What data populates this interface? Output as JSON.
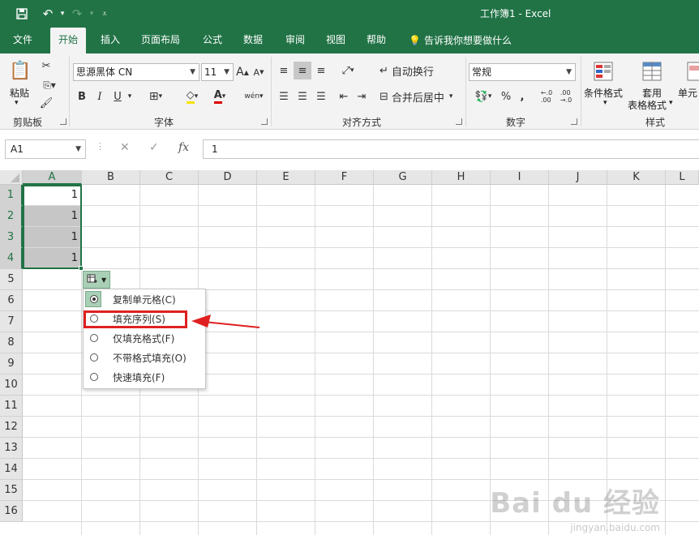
{
  "window": {
    "title": "工作簿1  -  Excel"
  },
  "quick_access": {
    "save_icon": "save-icon",
    "undo_icon": "undo-icon",
    "redo_icon": "redo-icon",
    "customize_icon": "customize-icon"
  },
  "tabs": [
    {
      "label": "文件"
    },
    {
      "label": "开始"
    },
    {
      "label": "插入"
    },
    {
      "label": "页面布局"
    },
    {
      "label": "公式"
    },
    {
      "label": "数据"
    },
    {
      "label": "审阅"
    },
    {
      "label": "视图"
    },
    {
      "label": "帮助"
    }
  ],
  "tell_me": "告诉我你想要做什么",
  "ribbon": {
    "clipboard": {
      "paste_label": "粘贴",
      "group_label": "剪贴板"
    },
    "font": {
      "font_name": "思源黑体 CN",
      "font_size": "11",
      "group_label": "字体",
      "bold": "B",
      "italic": "I",
      "underline": "U"
    },
    "alignment": {
      "wrap_text": "自动换行",
      "merge_center": "合并后居中",
      "group_label": "对齐方式"
    },
    "number": {
      "format": "常规",
      "percent": "%",
      "comma": ",",
      "group_label": "数字"
    },
    "styles": {
      "conditional": "条件格式",
      "table_line1": "套用",
      "table_line2": "表格格式",
      "cell_styles": "单元",
      "group_label": "样式"
    }
  },
  "formula_bar": {
    "name_box": "A1",
    "cancel": "✕",
    "enter": "✓",
    "fx": "fx",
    "value": "1"
  },
  "columns": [
    "A",
    "B",
    "C",
    "D",
    "E",
    "F",
    "G",
    "H",
    "I",
    "J",
    "K",
    "L"
  ],
  "rows": [
    "1",
    "2",
    "3",
    "4",
    "5",
    "6",
    "7",
    "8",
    "9",
    "10",
    "11",
    "12",
    "13",
    "14",
    "15",
    "16"
  ],
  "cells": {
    "A1": "1",
    "A2": "1",
    "A3": "1",
    "A4": "1"
  },
  "autofill_menu": {
    "items": [
      {
        "label": "复制单元格(C)",
        "selected": true
      },
      {
        "label": "填充序列(S)",
        "selected": false
      },
      {
        "label": "仅填充格式(F)",
        "selected": false
      },
      {
        "label": "不带格式填充(O)",
        "selected": false
      },
      {
        "label": "快速填充(F)",
        "selected": false
      }
    ]
  },
  "colors": {
    "excel_green": "#217346",
    "highlight": "#e02020",
    "selected_fill": "#c6c6c6"
  },
  "watermark": {
    "main": "Bai du 经验",
    "sub": "jingyan.baidu.com"
  }
}
